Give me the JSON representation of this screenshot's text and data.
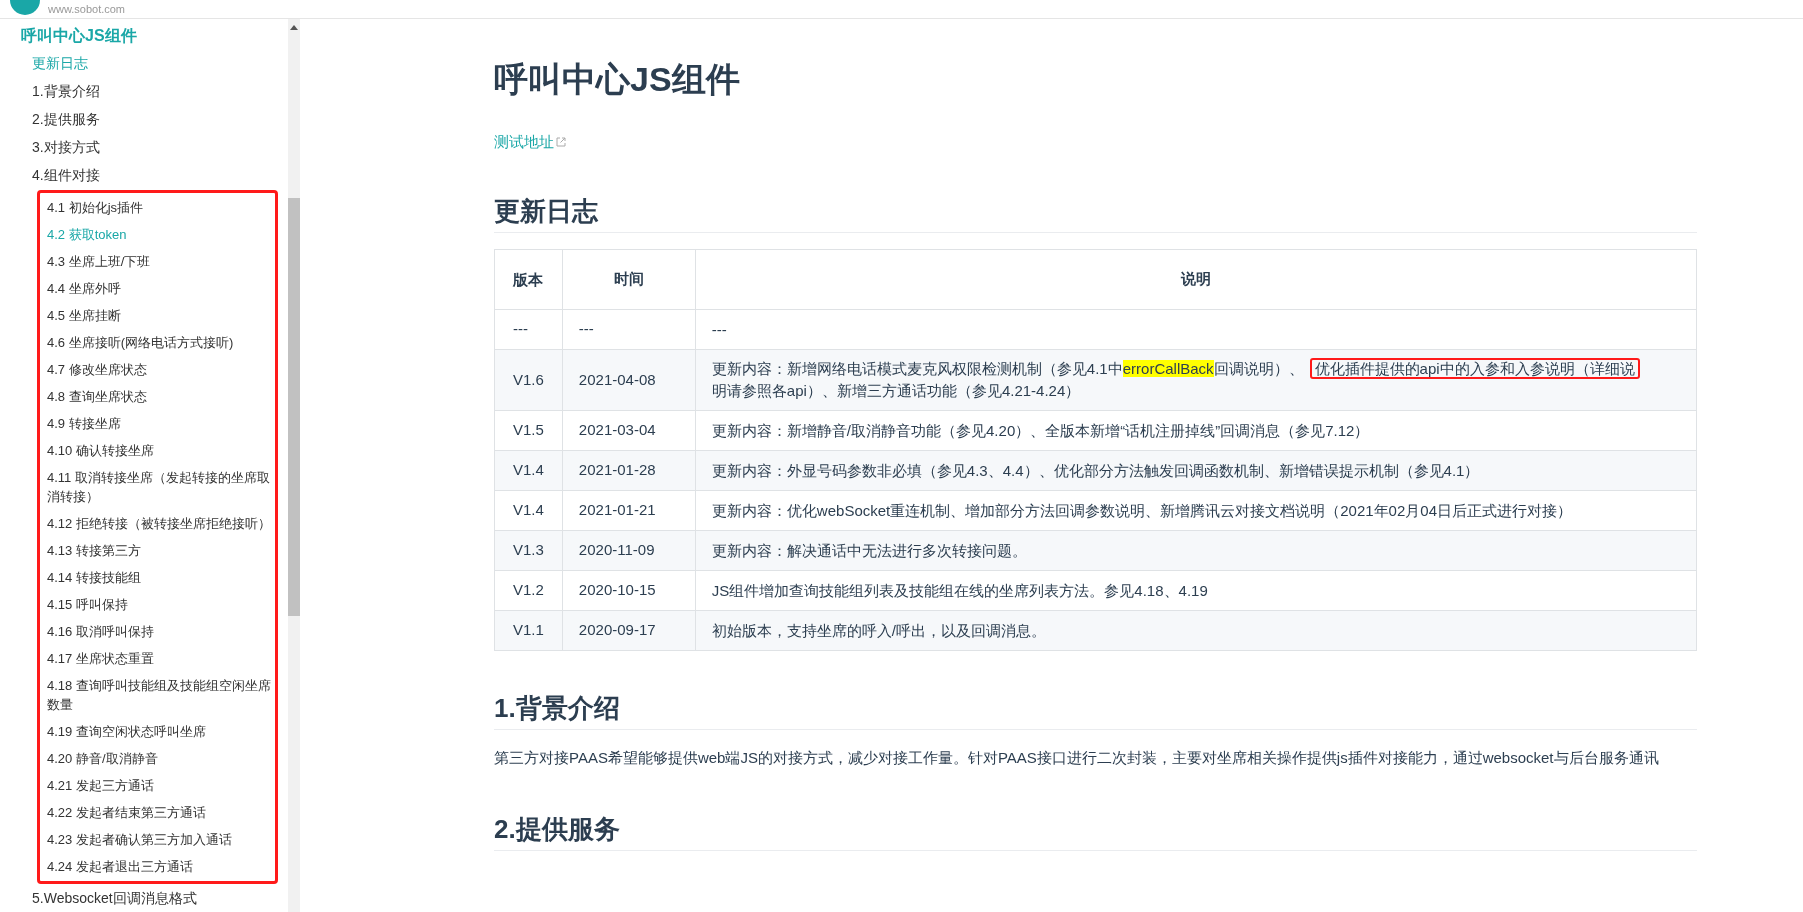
{
  "header": {
    "site": "www.sobot.com"
  },
  "sidebar": {
    "title": "呼叫中心JS组件",
    "items": [
      {
        "label": "更新日志",
        "selected": true
      },
      {
        "label": "1.背景介绍",
        "selected": false
      },
      {
        "label": "2.提供服务",
        "selected": false
      },
      {
        "label": "3.对接方式",
        "selected": false
      },
      {
        "label": "4.组件对接",
        "selected": false,
        "annotated": true,
        "children": [
          {
            "label": "4.1 初始化js插件",
            "selected": false
          },
          {
            "label": "4.2 获取token",
            "selected": true
          },
          {
            "label": "4.3 坐席上班/下班",
            "selected": false
          },
          {
            "label": "4.4 坐席外呼",
            "selected": false
          },
          {
            "label": "4.5 坐席挂断",
            "selected": false
          },
          {
            "label": "4.6 坐席接听(网络电话方式接听)",
            "selected": false
          },
          {
            "label": "4.7 修改坐席状态",
            "selected": false
          },
          {
            "label": "4.8 查询坐席状态",
            "selected": false
          },
          {
            "label": "4.9 转接坐席",
            "selected": false
          },
          {
            "label": "4.10 确认转接坐席",
            "selected": false
          },
          {
            "label": "4.11 取消转接坐席（发起转接的坐席取消转接）",
            "selected": false
          },
          {
            "label": "4.12 拒绝转接（被转接坐席拒绝接听）",
            "selected": false
          },
          {
            "label": "4.13 转接第三方",
            "selected": false
          },
          {
            "label": "4.14 转接技能组",
            "selected": false
          },
          {
            "label": "4.15 呼叫保持",
            "selected": false
          },
          {
            "label": "4.16 取消呼叫保持",
            "selected": false
          },
          {
            "label": "4.17 坐席状态重置",
            "selected": false
          },
          {
            "label": "4.18 查询呼叫技能组及技能组空闲坐席数量",
            "selected": false
          },
          {
            "label": "4.19 查询空闲状态呼叫坐席",
            "selected": false
          },
          {
            "label": "4.20 静音/取消静音",
            "selected": false
          },
          {
            "label": "4.21 发起三方通话",
            "selected": false
          },
          {
            "label": "4.22 发起者结束第三方通话",
            "selected": false
          },
          {
            "label": "4.23 发起者确认第三方加入通话",
            "selected": false
          },
          {
            "label": "4.24 发起者退出三方通话",
            "selected": false
          }
        ]
      },
      {
        "label": "5.Websocket回调消息格式",
        "selected": false
      }
    ]
  },
  "main": {
    "title": "呼叫中心JS组件",
    "link": "测试地址",
    "changelog": {
      "heading": "更新日志",
      "columns": [
        "版本",
        "时间",
        "说明"
      ],
      "rows": [
        {
          "version": "---",
          "date": "---",
          "description": [
            {
              "kind": "plain",
              "text": "---"
            }
          ]
        },
        {
          "version": "V1.6",
          "date": "2021-04-08",
          "description": [
            {
              "kind": "plain",
              "text": "更新内容：新增网络电话模式麦克风权限检测机制（参见4.1中"
            },
            {
              "kind": "highlight",
              "text": "errorCallBack"
            },
            {
              "kind": "plain",
              "text": "回调说明）、"
            },
            {
              "kind": "boxed",
              "text": "优化插件提供的api中的入参和入参说明（详细说"
            },
            {
              "kind": "plain",
              "text": "明请参照各api）、新增三方通话功能（参见4.21-4.24）"
            }
          ]
        },
        {
          "version": "V1.5",
          "date": "2021-03-04",
          "description": [
            {
              "kind": "plain",
              "text": "更新内容：新增静音/取消静音功能（参见4.20）、全版本新增“话机注册掉线”回调消息（参见7.12）"
            }
          ]
        },
        {
          "version": "V1.4",
          "date": "2021-01-28",
          "description": [
            {
              "kind": "plain",
              "text": "更新内容：外显号码参数非必填（参见4.3、4.4）、优化部分方法触发回调函数机制、新增错误提示机制（参见4.1）"
            }
          ]
        },
        {
          "version": "V1.4",
          "date": "2021-01-21",
          "description": [
            {
              "kind": "plain",
              "text": "更新内容：优化webSocket重连机制、增加部分方法回调参数说明、新增腾讯云对接文档说明（2021年02月04日后正式进行对接）"
            }
          ]
        },
        {
          "version": "V1.3",
          "date": "2020-11-09",
          "description": [
            {
              "kind": "plain",
              "text": "更新内容：解决通话中无法进行多次转接问题。"
            }
          ]
        },
        {
          "version": "V1.2",
          "date": "2020-10-15",
          "description": [
            {
              "kind": "plain",
              "text": "JS组件增加查询技能组列表及技能组在线的坐席列表方法。参见4.18、4.19"
            }
          ]
        },
        {
          "version": "V1.1",
          "date": "2020-09-17",
          "description": [
            {
              "kind": "plain",
              "text": "初始版本，支持坐席的呼入/呼出，以及回调消息。"
            }
          ]
        }
      ]
    },
    "sections": [
      {
        "heading": "1.背景介绍",
        "paragraph": "第三方对接PAAS希望能够提供web端JS的对接方式，减少对接工作量。针对PAAS接口进行二次封装，主要对坐席相关操作提供js插件对接能力，通过websocket与后台服务通讯"
      },
      {
        "heading": "2.提供服务"
      }
    ]
  }
}
